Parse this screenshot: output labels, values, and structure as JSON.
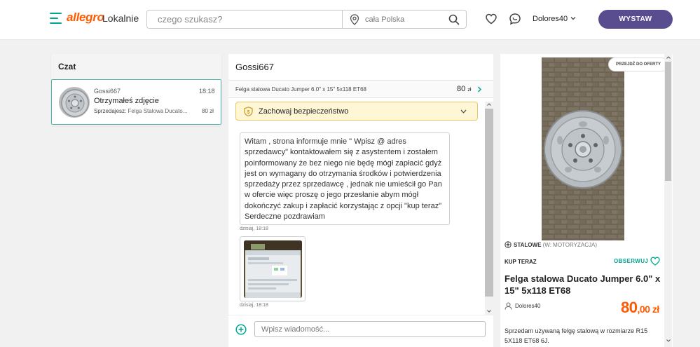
{
  "header": {
    "logo": "allegro",
    "logo_sub": "Lokalnie",
    "search_placeholder": "czego szukasz?",
    "location": "cała Polska",
    "username": "Dolores40",
    "post_button": "WYSTAW"
  },
  "chat_list": {
    "title": "Czat",
    "conversations": [
      {
        "user": "Gossi667",
        "time": "18:18",
        "last_message": "Otrzymałeś zdjęcie",
        "seller_label": "Sprzedajesz:",
        "item": "Felga Stalowa Ducato...",
        "price": "80 zł"
      }
    ]
  },
  "conversation": {
    "title": "Gossi667",
    "offer_name": "Felga stalowa Ducato Jumper 6.0\" x 15\" 5x118 ET68",
    "offer_price": "80",
    "offer_currency": "zł",
    "safety_label": "Zachowaj bezpieczeństwo",
    "messages": [
      {
        "type": "text",
        "text": "Witam , strona informuje mnie \" Wpisz @ adres sprzedawcy\" kontaktowałem się z asystentem i zostałem poinformowany że bez niego nie będę mógł zapłacić gdyż jest on wymagany do otrzymania środków i potwierdzenia sprzedaży przez sprzedawcę , jednak nie umieścił go Pan w ofercie więc proszę o jego przesłanie abym mógł dokończyć zakup i zapłacić korzystając z opcji \"kup teraz\" Serdeczne pozdrawiam",
        "time": "dzisiaj, 18:18"
      },
      {
        "type": "image",
        "time": "dzisiaj, 18:18"
      }
    ],
    "input_placeholder": "Wpisz wiadomość..."
  },
  "offer": {
    "goto_button": "PRZEJDŹ DO OFERTY",
    "category": "STALOWE",
    "category_parent": "(W: MOTORYZACJA)",
    "buy_type": "KUP TERAZ",
    "watch_label": "OBSERWUJ",
    "title": "Felga stalowa Ducato Jumper 6.0\" x 15\" 5x118 ET68",
    "seller": "Dolores40",
    "price_main": "80",
    "price_fraction": ",00 zł",
    "description": "Sprzedam używaną felgę stalową w rozmiarze R15 5X118 ET68 6J."
  },
  "colors": {
    "brand_orange": "#ff5a00",
    "accent_teal": "#00a790",
    "button_purple": "#5a4d8f",
    "safety_bg": "#fff6d6"
  }
}
